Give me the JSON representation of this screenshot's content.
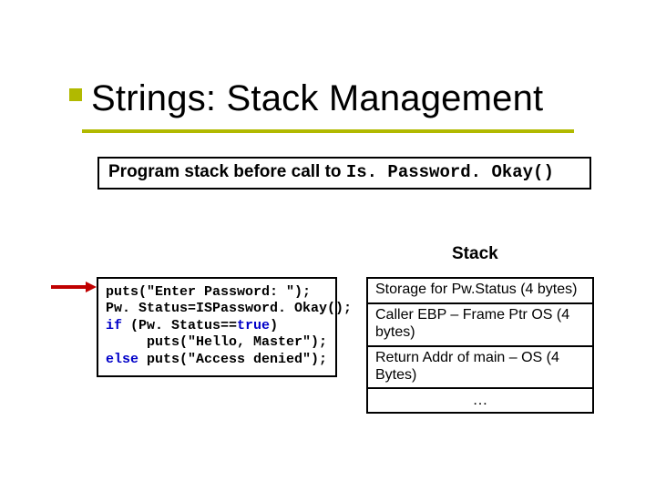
{
  "title": "Strings: Stack Management",
  "caption": {
    "lead": "Program stack before call to ",
    "code": "Is. Password. Okay()"
  },
  "stack_label": "Stack",
  "code": {
    "l1": "puts(\"Enter Password: \");",
    "l2": "Pw. Status=ISPassword. Okay();",
    "l3a": "if",
    "l3b": " (Pw. Status==",
    "l3c": "true",
    "l3d": ")",
    "l4": "     puts(\"Hello, Master\");",
    "l5a": "else",
    "l5b": " puts(\"Access denied\");"
  },
  "stack_rows": {
    "r1": "Storage for Pw.Status (4 bytes)",
    "r2": "Caller EBP – Frame Ptr OS (4 bytes)",
    "r3": "Return Addr of main – OS (4 Bytes)",
    "r4": "…"
  }
}
